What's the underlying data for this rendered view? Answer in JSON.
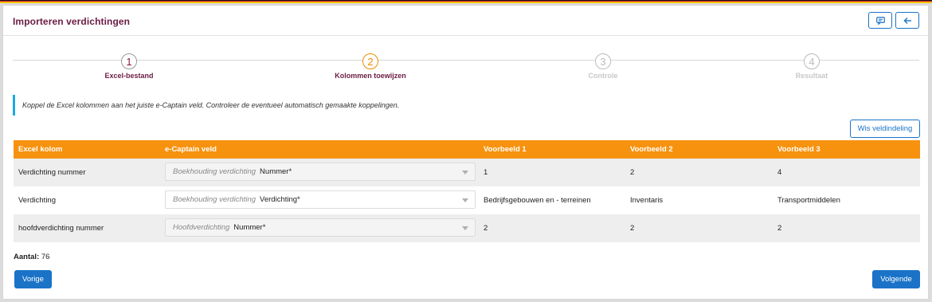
{
  "header": {
    "title": "Importeren verdichtingen",
    "chat_icon": "comment-icon",
    "back_icon": "arrow-left-icon"
  },
  "steps": [
    {
      "num": "1",
      "label": "Excel-bestand",
      "state": "done"
    },
    {
      "num": "2",
      "label": "Kolommen toewijzen",
      "state": "active"
    },
    {
      "num": "3",
      "label": "Controle",
      "state": "pending"
    },
    {
      "num": "4",
      "label": "Resultaat",
      "state": "pending"
    }
  ],
  "info_text": "Koppel de Excel kolommen aan het juiste e-Captain veld. Controleer de eventueel automatisch gemaakte koppelingen.",
  "wis_button": "Wis veldindeling",
  "table": {
    "headers": [
      "Excel kolom",
      "e-Captain veld",
      "Voorbeeld 1",
      "Voorbeeld 2",
      "Voorbeeld 3"
    ],
    "rows": [
      {
        "excel": "Verdichting nummer",
        "field_prefix": "Boekhouding verdichting",
        "field": "Nummer*",
        "ex1": "1",
        "ex2": "2",
        "ex3": "4"
      },
      {
        "excel": "Verdichting",
        "field_prefix": "Boekhouding verdichting",
        "field": "Verdichting*",
        "ex1": "Bedrijfsgebouwen en - terreinen",
        "ex2": "Inventaris",
        "ex3": "Transportmiddelen"
      },
      {
        "excel": "hoofdverdichting nummer",
        "field_prefix": "Hoofdverdichting",
        "field": "Nummer*",
        "ex1": "2",
        "ex2": "2",
        "ex3": "2"
      }
    ]
  },
  "count": {
    "label": "Aantal:",
    "value": "76"
  },
  "buttons": {
    "prev": "Vorige",
    "next": "Volgende"
  },
  "colors": {
    "accent": "#1a73c7",
    "header_orange": "#f7920f",
    "title": "#6b1c45",
    "active_step": "#f08c00",
    "info_bar": "#1ea7e0"
  }
}
